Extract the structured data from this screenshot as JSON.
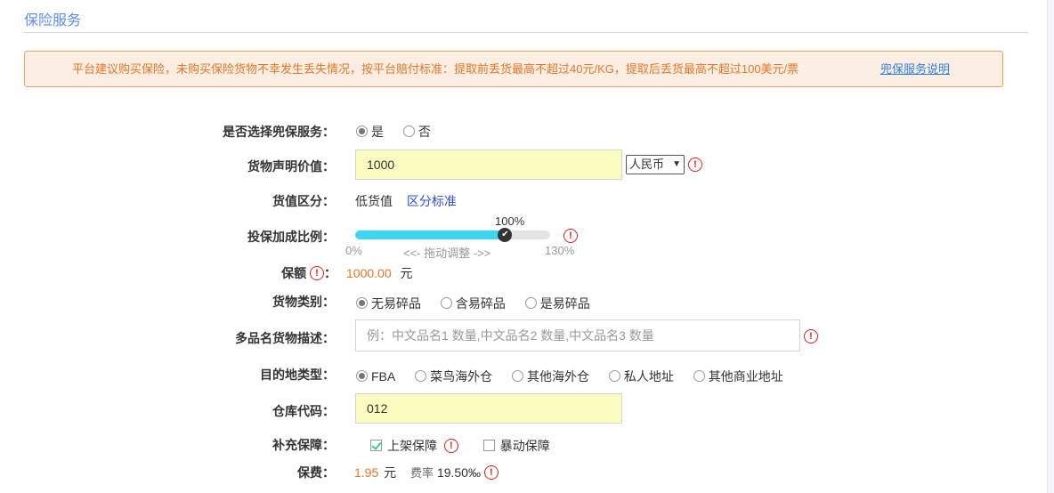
{
  "section_title": "保险服务",
  "notice": {
    "text": "平台建议购买保险，未购买保险货物不幸发生丢失情况，按平台赔付标准：提取前丢货最高不超过40元/KG，提取后丢货最高不超过100美元/票",
    "link": "兜保服务说明"
  },
  "form": {
    "service": {
      "label": "是否选择兜保服务：",
      "options": [
        "是",
        "否"
      ],
      "selected": "是"
    },
    "declared_value": {
      "label": "货物声明价值：",
      "value": "1000",
      "currency": "人民币"
    },
    "value_class": {
      "label": "货值区分：",
      "value": "低货值",
      "link": "区分标准"
    },
    "ratio": {
      "label": "投保加成比例：",
      "current": "100%",
      "min": "0%",
      "max": "130%",
      "hint": "<<- 拖动调整 ->>",
      "fraction": 0.7692
    },
    "amount": {
      "label": "保额",
      "value": "1000.00",
      "unit": "元"
    },
    "cargo_type": {
      "label": "货物类别：",
      "options": [
        "无易碎品",
        "含易碎品",
        "是易碎品"
      ],
      "selected": "无易碎品"
    },
    "description": {
      "label": "多品名货物描述：",
      "placeholder": "例：中文品名1 数量,中文品名2 数量,中文品名3 数量"
    },
    "destination": {
      "label": "目的地类型：",
      "options": [
        "FBA",
        "菜鸟海外仓",
        "其他海外仓",
        "私人地址",
        "其他商业地址"
      ],
      "selected": "FBA"
    },
    "warehouse_code": {
      "label": "仓库代码：",
      "value": "012"
    },
    "extra": {
      "label": "补充保障：",
      "options": [
        {
          "text": "上架保障",
          "checked": true
        },
        {
          "text": "暴动保障",
          "checked": false
        }
      ]
    },
    "premium": {
      "label": "保费：",
      "value": "1.95",
      "unit": "元",
      "rate_label": "费率",
      "rate": "19.50‰"
    }
  },
  "colors": {
    "accent": "#5b8def",
    "warn": "#e02020",
    "orange": "#e67626",
    "slider": "#3dd6f0",
    "input_bg": "#fbfdc0"
  }
}
